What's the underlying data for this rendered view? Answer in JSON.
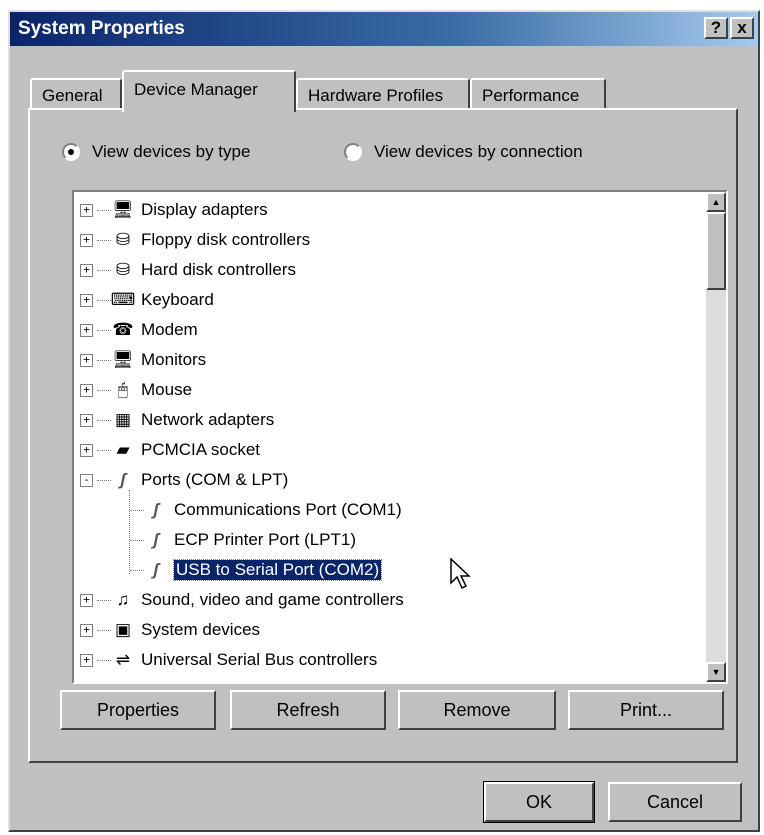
{
  "window": {
    "title": "System Properties",
    "help_btn": "?",
    "close_btn": "x"
  },
  "tabs": [
    {
      "label": "General"
    },
    {
      "label": "Device Manager"
    },
    {
      "label": "Hardware Profiles"
    },
    {
      "label": "Performance"
    }
  ],
  "view_options": {
    "by_type": "View devices by type",
    "by_connection": "View devices by connection",
    "selected": "by_type"
  },
  "tree": {
    "items": [
      {
        "label": "Display adapters",
        "icon": "monitor-icon",
        "expander": "+"
      },
      {
        "label": "Floppy disk controllers",
        "icon": "drive-icon",
        "expander": "+"
      },
      {
        "label": "Hard disk controllers",
        "icon": "drive-icon",
        "expander": "+"
      },
      {
        "label": "Keyboard",
        "icon": "keyboard-icon",
        "expander": "+"
      },
      {
        "label": "Modem",
        "icon": "modem-icon",
        "expander": "+"
      },
      {
        "label": "Monitors",
        "icon": "monitor-icon",
        "expander": "+"
      },
      {
        "label": "Mouse",
        "icon": "mouse-icon",
        "expander": "+"
      },
      {
        "label": "Network adapters",
        "icon": "network-card-icon",
        "expander": "+"
      },
      {
        "label": "PCMCIA socket",
        "icon": "pcmcia-icon",
        "expander": "+"
      },
      {
        "label": "Ports (COM & LPT)",
        "icon": "port-icon",
        "expander": "-"
      },
      {
        "label": "Communications Port (COM1)",
        "icon": "port-icon"
      },
      {
        "label": "ECP Printer Port (LPT1)",
        "icon": "port-icon"
      },
      {
        "label": "USB to Serial Port (COM2)",
        "icon": "port-icon"
      },
      {
        "label": "Sound, video and game controllers",
        "icon": "sound-icon",
        "expander": "+"
      },
      {
        "label": "System devices",
        "icon": "computer-icon",
        "expander": "+"
      },
      {
        "label": "Universal Serial Bus controllers",
        "icon": "usb-icon",
        "expander": "+"
      }
    ]
  },
  "buttons": {
    "properties": "Properties",
    "refresh": "Refresh",
    "remove": "Remove",
    "print": "Print...",
    "ok": "OK",
    "cancel": "Cancel"
  },
  "colors": {
    "face": "#c0c0c0",
    "title_start": "#0a246a",
    "selection": "#0a246a"
  }
}
